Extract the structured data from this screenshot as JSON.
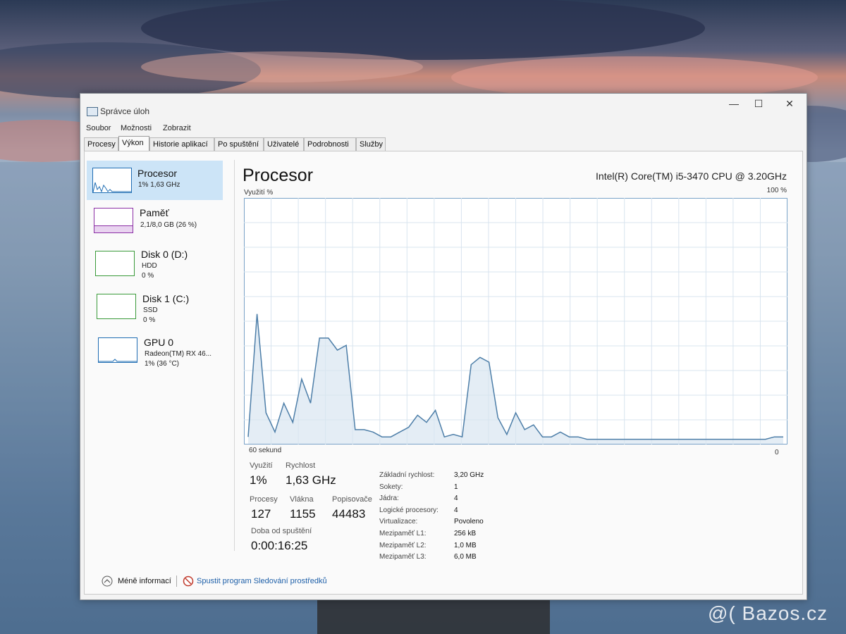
{
  "window": {
    "title": "Správce úloh",
    "controls": {
      "minimize": "—",
      "maximize": "☐",
      "close": "✕"
    }
  },
  "menu": [
    "Soubor",
    "Možnosti",
    "Zobrazit"
  ],
  "tabs": [
    "Procesy",
    "Výkon",
    "Historie aplikací",
    "Po spuštění",
    "Uživatelé",
    "Podrobnosti",
    "Služby"
  ],
  "active_tab": "Výkon",
  "sidebar": {
    "items": [
      {
        "title": "Procesor",
        "sub1": "1% 1,63 GHz",
        "sub2": "",
        "color": "#1f6db3"
      },
      {
        "title": "Paměť",
        "sub1": "2,1/8,0 GB (26 %)",
        "sub2": "",
        "color": "#8b2fa5"
      },
      {
        "title": "Disk 0 (D:)",
        "sub1": "HDD",
        "sub2": "0 %",
        "color": "#3a9a3a"
      },
      {
        "title": "Disk 1 (C:)",
        "sub1": "SSD",
        "sub2": "0 %",
        "color": "#3a9a3a"
      },
      {
        "title": "GPU 0",
        "sub1": "Radeon(TM) RX 46...",
        "sub2": "1% (36 °C)",
        "color": "#1f6db3"
      }
    ]
  },
  "main": {
    "title": "Procesor",
    "cpu_name": "Intel(R) Core(TM) i5-3470 CPU @ 3.20GHz",
    "graph_top_left": "Využití %",
    "graph_top_right": "100 %",
    "graph_bottom_left": "60 sekund",
    "graph_bottom_right": "0"
  },
  "stats": {
    "usage_label": "Využití",
    "usage_value": "1%",
    "speed_label": "Rychlost",
    "speed_value": "1,63 GHz",
    "processes_label": "Procesy",
    "processes_value": "127",
    "threads_label": "Vlákna",
    "threads_value": "1155",
    "handles_label": "Popisovače",
    "handles_value": "44483",
    "uptime_label": "Doba od spuštění",
    "uptime_value": "0:00:16:25"
  },
  "details": [
    {
      "label": "Základní rychlost:",
      "value": "3,20 GHz"
    },
    {
      "label": "Sokety:",
      "value": "1"
    },
    {
      "label": "Jádra:",
      "value": "4"
    },
    {
      "label": "Logické procesory:",
      "value": "4"
    },
    {
      "label": "Virtualizace:",
      "value": "Povoleno"
    },
    {
      "label": "Mezipaměť L1:",
      "value": "256 kB"
    },
    {
      "label": "Mezipaměť L2:",
      "value": "1,0 MB"
    },
    {
      "label": "Mezipaměť L3:",
      "value": "6,0 MB"
    }
  ],
  "footer": {
    "less_info": "Méně informací",
    "resource_monitor": "Spustit program Sledování prostředků"
  },
  "watermark": "@( Bazos.cz",
  "colors": {
    "accent": "#1f6db3",
    "graph_line": "#4d7ea8",
    "graph_fill": "#d9e6f1",
    "grid": "#d8e4ef"
  },
  "chart_data": {
    "type": "area",
    "xlabel": "60 sekund",
    "ylabel": "Využití %",
    "xlim": [
      60,
      0
    ],
    "ylim": [
      0,
      100
    ],
    "x": [
      60,
      59,
      58,
      57,
      56,
      55,
      54,
      53,
      52,
      51,
      50,
      49,
      48,
      47,
      46,
      45,
      44,
      43,
      42,
      41,
      40,
      39,
      38,
      37,
      36,
      35,
      34,
      33,
      32,
      31,
      30,
      29,
      28,
      27,
      26,
      25,
      24,
      23,
      22,
      21,
      20,
      19,
      18,
      17,
      16,
      15,
      14,
      13,
      12,
      11,
      10,
      9,
      8,
      7,
      6,
      5,
      4,
      3,
      2,
      1,
      0
    ],
    "values": [
      2,
      53,
      12,
      4,
      16,
      8,
      26,
      16,
      43,
      43,
      38,
      40,
      5,
      5,
      4,
      2,
      2,
      4,
      6,
      11,
      8,
      13,
      2,
      3,
      2,
      32,
      35,
      33,
      10,
      3,
      12,
      5,
      7,
      2,
      2,
      4,
      2,
      2,
      1,
      1,
      1,
      1,
      1,
      1,
      1,
      1,
      1,
      1,
      1,
      1,
      1,
      1,
      1,
      1,
      1,
      1,
      1,
      1,
      1,
      2,
      2
    ]
  }
}
